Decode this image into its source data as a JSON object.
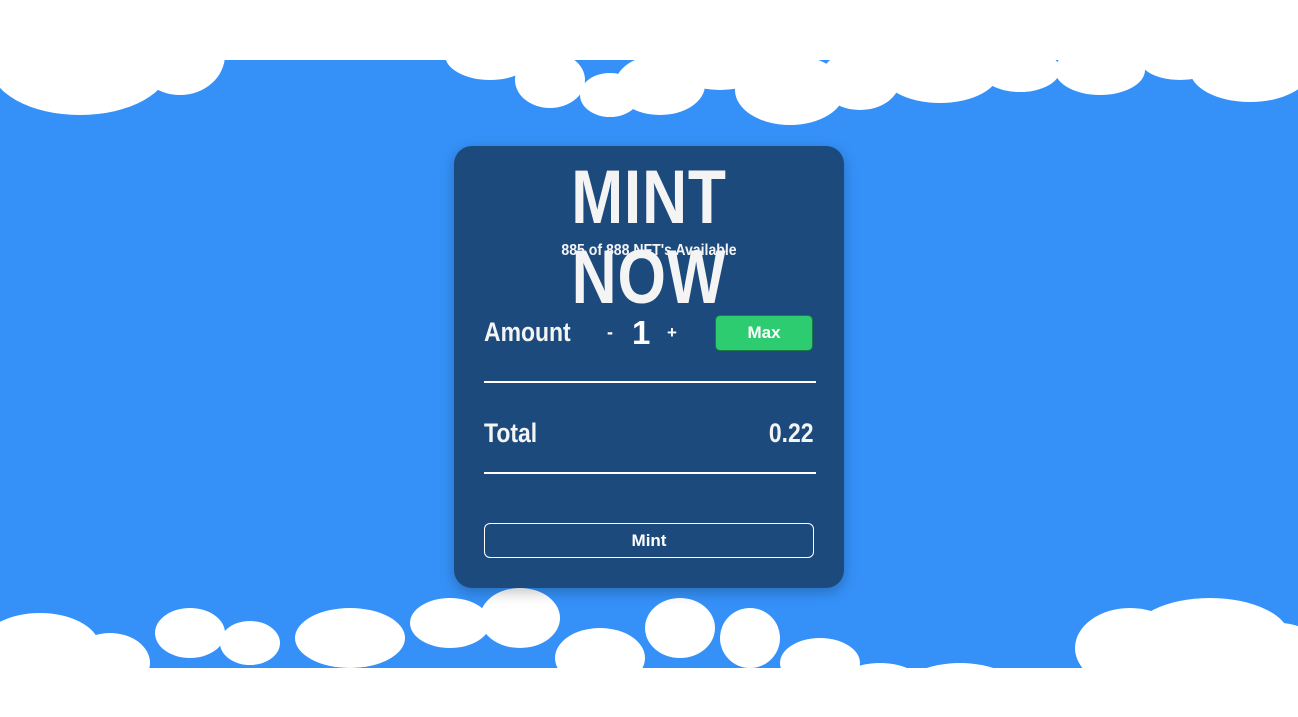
{
  "colors": {
    "background": "#3591f8",
    "card": "#1c4a7d",
    "max_button": "#2ecc71",
    "clouds": "#ffffff"
  },
  "card": {
    "title": "MINT NOW",
    "availability": "885 of 888 NFT's Available",
    "amount_label": "Amount",
    "decrement_label": "-",
    "quantity": "1",
    "increment_label": "+",
    "max_label": "Max",
    "total_label": "Total",
    "total_value": "0.22",
    "mint_label": "Mint"
  }
}
